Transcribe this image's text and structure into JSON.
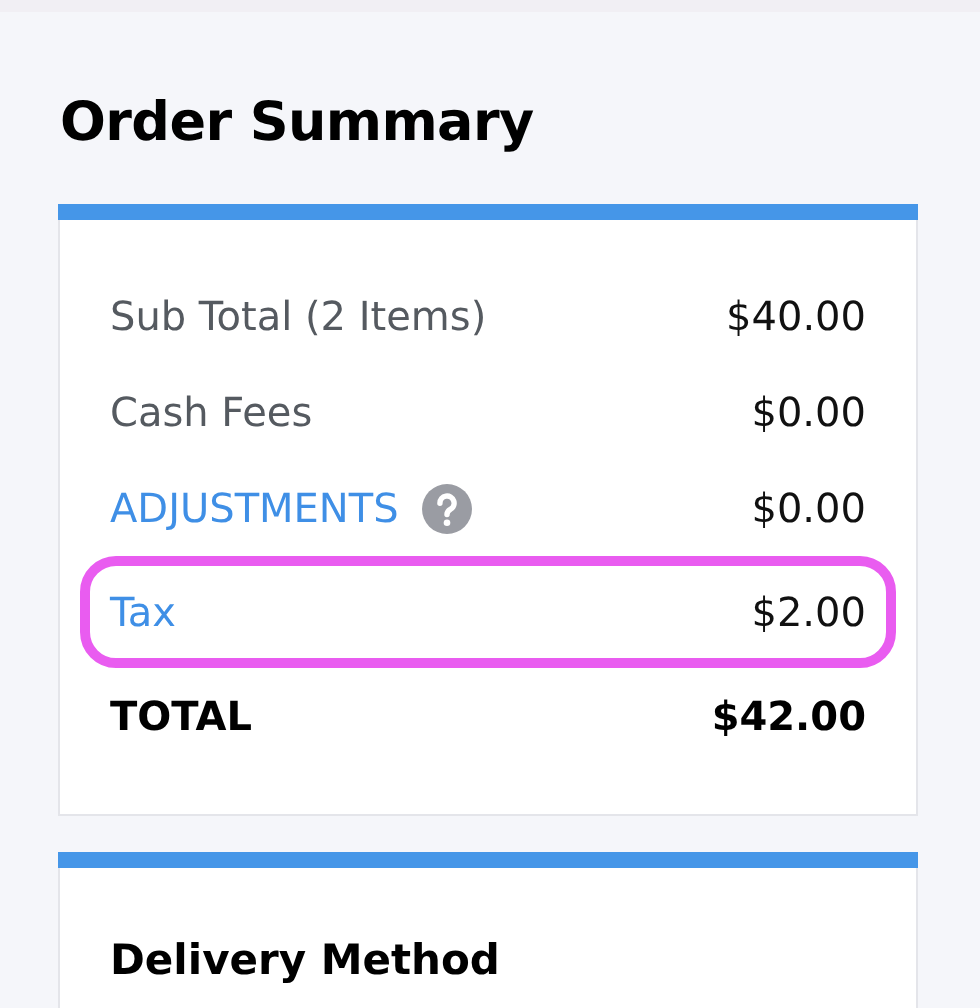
{
  "title": "Order Summary",
  "summary": {
    "rows": [
      {
        "kind": "plain",
        "label": "Sub Total (2 Items)",
        "value": "$40.00",
        "help": false,
        "highlighted": false
      },
      {
        "kind": "plain",
        "label": "Cash Fees",
        "value": "$0.00",
        "help": false,
        "highlighted": false
      },
      {
        "kind": "link",
        "label": "ADJUSTMENTS",
        "value": "$0.00",
        "help": true,
        "highlighted": false
      },
      {
        "kind": "link",
        "label": "Tax",
        "value": "$2.00",
        "help": false,
        "highlighted": true
      },
      {
        "kind": "total",
        "label": "TOTAL",
        "value": "$42.00",
        "help": false,
        "highlighted": false
      }
    ]
  },
  "delivery": {
    "heading": "Delivery Method"
  }
}
